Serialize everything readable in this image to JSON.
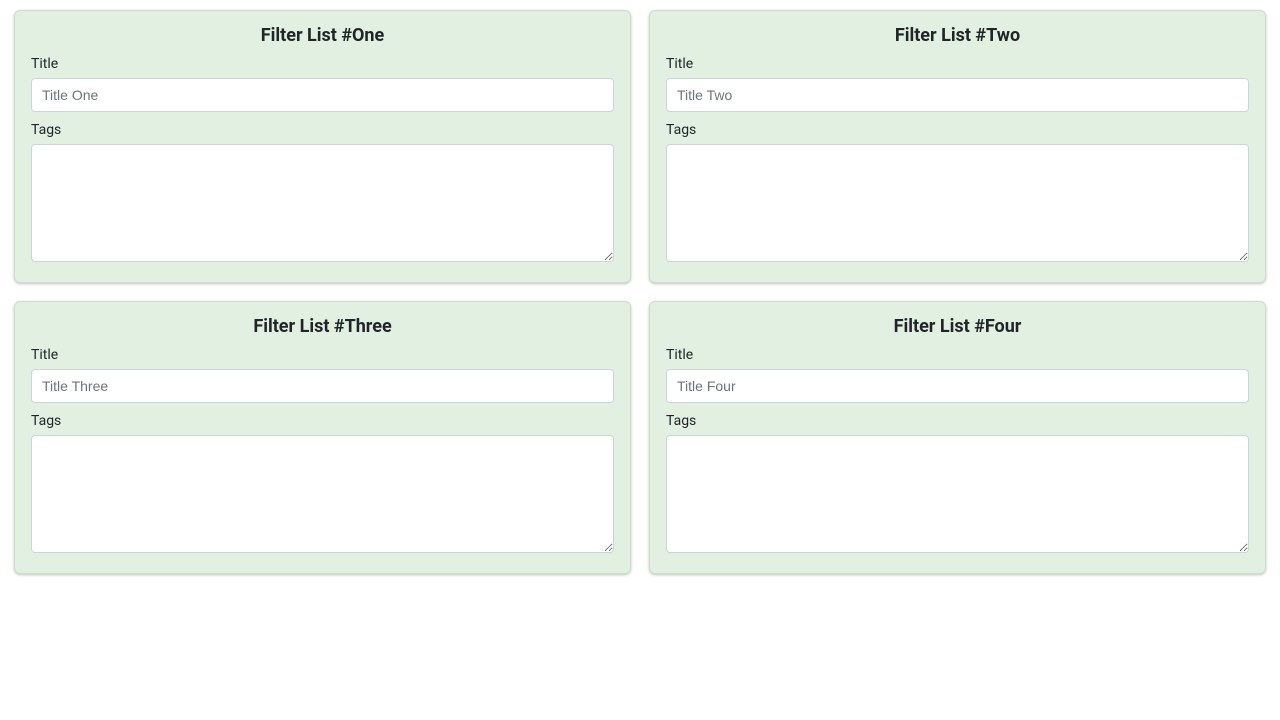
{
  "cards": [
    {
      "heading": "Filter List #One",
      "title_label": "Title",
      "title_placeholder": "Title One",
      "title_value": "",
      "tags_label": "Tags",
      "tags_value": ""
    },
    {
      "heading": "Filter List #Two",
      "title_label": "Title",
      "title_placeholder": "Title Two",
      "title_value": "",
      "tags_label": "Tags",
      "tags_value": ""
    },
    {
      "heading": "Filter List #Three",
      "title_label": "Title",
      "title_placeholder": "Title Three",
      "title_value": "",
      "tags_label": "Tags",
      "tags_value": ""
    },
    {
      "heading": "Filter List #Four",
      "title_label": "Title",
      "title_placeholder": "Title Four",
      "title_value": "",
      "tags_label": "Tags",
      "tags_value": ""
    }
  ]
}
